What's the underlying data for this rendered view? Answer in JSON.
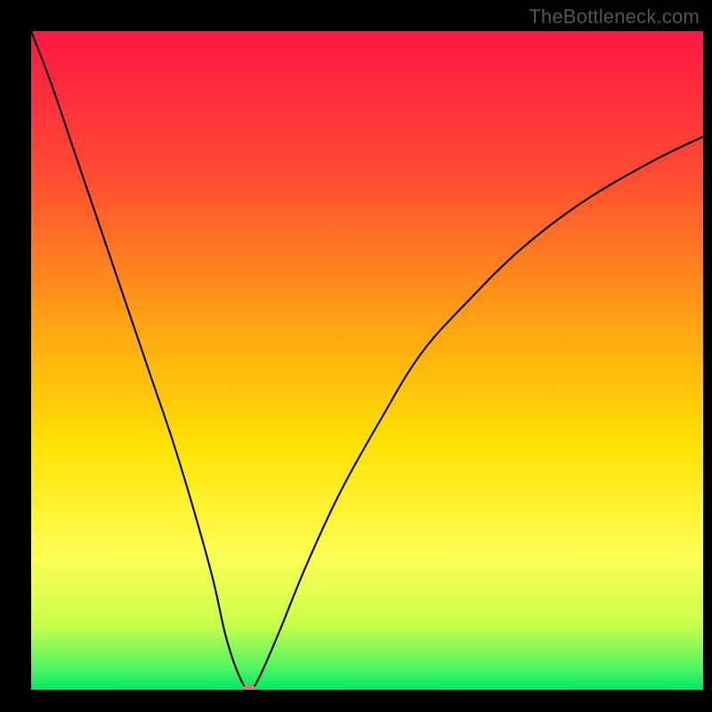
{
  "watermark": "TheBottleneck.com",
  "chart_data": {
    "type": "line",
    "title": "",
    "xlabel": "",
    "ylabel": "",
    "xlim": [
      0,
      100
    ],
    "ylim": [
      0,
      100
    ],
    "grid": false,
    "legend": false,
    "series": [
      {
        "name": "bottleneck-curve",
        "x": [
          0,
          3,
          6,
          9,
          12,
          15,
          18,
          21,
          24,
          27,
          29,
          31,
          32.5,
          34,
          37,
          41,
          46,
          52,
          58,
          65,
          73,
          82,
          92,
          100
        ],
        "y": [
          100,
          92,
          83,
          74,
          65,
          56,
          47,
          38,
          28,
          17,
          8,
          2,
          0,
          2,
          9,
          19,
          30,
          41,
          51,
          59,
          67,
          74,
          80,
          84
        ]
      }
    ],
    "marker": {
      "x": 32.5,
      "y": 0,
      "name": "optimal-point",
      "color": "#cf8074"
    },
    "gradient_stops": [
      {
        "pos": 0.0,
        "color": "#ff1744"
      },
      {
        "pos": 0.22,
        "color": "#ff4c33"
      },
      {
        "pos": 0.45,
        "color": "#ffa512"
      },
      {
        "pos": 0.63,
        "color": "#ffe205"
      },
      {
        "pos": 0.8,
        "color": "#fdff55"
      },
      {
        "pos": 0.9,
        "color": "#c9ff4a"
      },
      {
        "pos": 0.965,
        "color": "#55f563"
      },
      {
        "pos": 1.0,
        "color": "#00e865"
      }
    ]
  }
}
